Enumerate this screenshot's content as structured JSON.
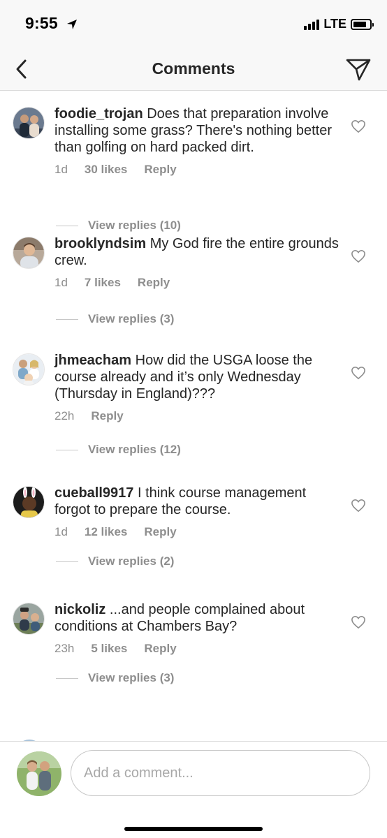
{
  "status_bar": {
    "time": "9:55",
    "network": "LTE",
    "location_icon": "location-arrow-icon",
    "signal_icon": "signal-bars-icon",
    "battery_icon": "battery-icon"
  },
  "nav": {
    "title": "Comments",
    "back_icon": "chevron-left-icon",
    "send_icon": "paper-plane-icon"
  },
  "comments": [
    {
      "username": "foodie_trojan",
      "text": "Does that preparation involve installing some grass? There's nothing better than golfing on hard packed dirt.",
      "time": "1d",
      "likes": "30 likes",
      "reply": "Reply",
      "view_replies": "View replies (10)"
    },
    {
      "username": "brooklyndsim",
      "text": "My God fire the entire grounds crew.",
      "time": "1d",
      "likes": "7 likes",
      "reply": "Reply",
      "view_replies": "View replies (3)"
    },
    {
      "username": "jhmeacham",
      "text": "How did the USGA loose the course already and it’s only Wednesday (Thursday in England)???",
      "time": "22h",
      "likes": "",
      "reply": "Reply",
      "view_replies": "View replies (12)"
    },
    {
      "username": "cueball9917",
      "text": "I think course management forgot to prepare the course.",
      "time": "1d",
      "likes": "12 likes",
      "reply": "Reply",
      "view_replies": "View replies (2)"
    },
    {
      "username": "nickoliz",
      "text": "...and people complained about conditions at Chambers Bay?",
      "time": "23h",
      "likes": "5 likes",
      "reply": "Reply",
      "view_replies": "View replies (3)"
    }
  ],
  "composer": {
    "placeholder": "Add a comment..."
  },
  "colors": {
    "text": "#262626",
    "secondary": "#8e8e8e",
    "border": "#dbdbdb",
    "bar_bg": "#f8f8f8"
  }
}
